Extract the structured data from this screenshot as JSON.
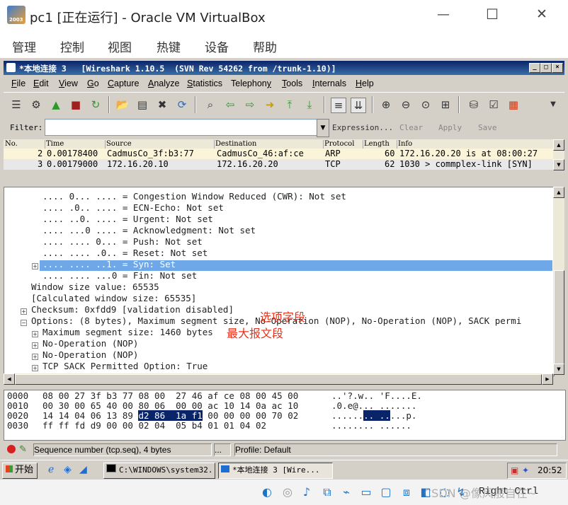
{
  "host": {
    "title": "pc1 [正在运行] - Oracle VM VirtualBox",
    "menu": [
      "管理",
      "控制",
      "视图",
      "热键",
      "设备",
      "帮助"
    ],
    "controls": {
      "minimize": "—",
      "maximize": "☐",
      "close": "✕"
    },
    "logo_text": "2003"
  },
  "wireshark": {
    "title": "*本地连接 3   [Wireshark 1.10.5  (SVN Rev 54262 from /trunk-1.10)]",
    "menu": [
      {
        "label": "File",
        "key": "F",
        "rest": "ile"
      },
      {
        "label": "Edit",
        "key": "E",
        "rest": "dit"
      },
      {
        "label": "View",
        "key": "V",
        "rest": "iew"
      },
      {
        "label": "Go",
        "key": "G",
        "rest": "o"
      },
      {
        "label": "Capture",
        "key": "C",
        "rest": "apture"
      },
      {
        "label": "Analyze",
        "key": "A",
        "rest": "nalyze"
      },
      {
        "label": "Statistics",
        "key": "S",
        "rest": "tatistics"
      },
      {
        "label": "Telephony",
        "key": "y",
        "rest": "Telephon"
      },
      {
        "label": "Tools",
        "key": "T",
        "rest": "ools"
      },
      {
        "label": "Internals",
        "key": "I",
        "rest": "nternals"
      },
      {
        "label": "Help",
        "key": "H",
        "rest": "elp"
      }
    ],
    "filter": {
      "label": "Filter:",
      "value": "",
      "expression": "Expression...",
      "clear": "Clear",
      "apply": "Apply",
      "save": "Save"
    },
    "packet_list": {
      "columns": [
        "No.",
        "Time",
        "Source",
        "Destination",
        "Protocol",
        "Length",
        "Info"
      ],
      "rows": [
        {
          "no": "2",
          "time": "0.00178400",
          "source": "CadmusCo_3f:b3:77",
          "destination": "CadmusCo_46:af:ce",
          "protocol": "ARP",
          "length": "60",
          "info": "172.16.20.20 is at 08:00:27"
        },
        {
          "no": "3",
          "time": "0.00179000",
          "source": "172.16.20.10",
          "destination": "172.16.20.20",
          "protocol": "TCP",
          "length": "62",
          "info": "1030 > commplex-link [SYN]"
        }
      ]
    },
    "details": [
      {
        "text": ".... 0... .... = Congestion Window Reduced (CWR): Not set",
        "indent": 3,
        "expander": ""
      },
      {
        "text": ".... .0.. .... = ECN-Echo: Not set",
        "indent": 3,
        "expander": ""
      },
      {
        "text": ".... ..0. .... = Urgent: Not set",
        "indent": 3,
        "expander": ""
      },
      {
        "text": ".... ...0 .... = Acknowledgment: Not set",
        "indent": 3,
        "expander": ""
      },
      {
        "text": ".... .... 0... = Push: Not set",
        "indent": 3,
        "expander": ""
      },
      {
        "text": ".... .... .0.. = Reset: Not set",
        "indent": 3,
        "expander": ""
      },
      {
        "text": ".... .... ..1. = Syn: Set",
        "indent": 3,
        "expander": "+",
        "selected": true
      },
      {
        "text": ".... .... ...0 = Fin: Not set",
        "indent": 3,
        "expander": ""
      },
      {
        "text": "Window size value: 65535",
        "indent": 2,
        "expander": ""
      },
      {
        "text": "[Calculated window size: 65535]",
        "indent": 2,
        "expander": ""
      },
      {
        "text": "Checksum: 0xfdd9 [validation disabled]",
        "indent": 1,
        "expander": "+"
      },
      {
        "text": "Options: (8 bytes), Maximum segment size, No-Operation (NOP), No-Operation (NOP), SACK permi",
        "indent": 1,
        "expander": "−"
      },
      {
        "text": "Maximum segment size: 1460 bytes",
        "indent": 2,
        "expander": "+"
      },
      {
        "text": "No-Operation (NOP)",
        "indent": 2,
        "expander": "+"
      },
      {
        "text": "No-Operation (NOP)",
        "indent": 2,
        "expander": "+"
      },
      {
        "text": "TCP SACK Permitted Option: True",
        "indent": 2,
        "expander": "+"
      }
    ],
    "annotations": {
      "options": "选项字段",
      "mss": "最大报文段"
    },
    "bytes": [
      {
        "offset": "0000",
        "hex_a": "08 00 27 3f b3 77 08 00  27 46 af ce 08 00 45 00",
        "ascii": "..'?.w.. 'F....E."
      },
      {
        "offset": "0010",
        "hex_a": "00 30 00 65 40 00 80 06  00 00 ac 10 14 0a ac 10",
        "ascii": ".0.e@... ......."
      },
      {
        "offset": "0020",
        "hex_pre": "14 14 04 06 13 89 ",
        "hex_hl": "d2 86  1a f1",
        "hex_post": " 00 00 00 00 70 02",
        "ascii_pre": "......",
        "ascii_hl": ".. ..",
        "ascii_post": "...p."
      },
      {
        "offset": "0030",
        "hex_a": "ff ff fd d9 00 00 02 04  05 b4 01 01 04 02",
        "ascii": "........ ......"
      }
    ],
    "status": {
      "field": "Sequence number (tcp.seq), 4 bytes",
      "middle": "...",
      "profile": "Profile: Default"
    }
  },
  "taskbar": {
    "start": "开始",
    "tasks": [
      "C:\\WINDOWS\\system32...",
      "*本地连接 3   [Wire..."
    ],
    "clock": "20:52"
  },
  "vbox_status": {
    "host_key": "Right Ctrl",
    "watermark": "CSDN @像风般自在~"
  }
}
